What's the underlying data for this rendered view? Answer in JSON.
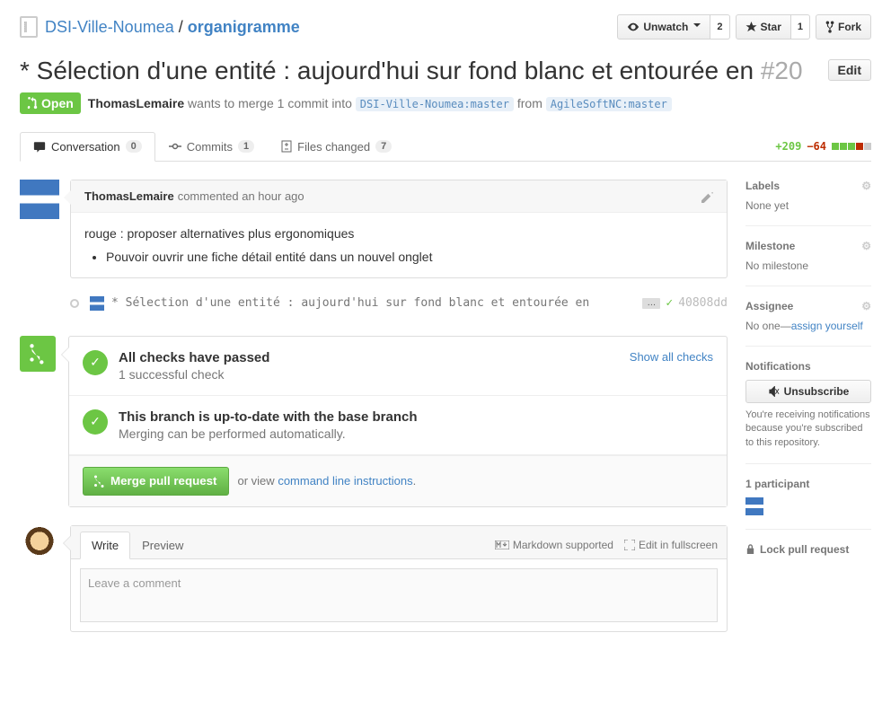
{
  "breadcrumb": {
    "owner": "DSI-Ville-Noumea",
    "sep": "/",
    "repo": "organigramme"
  },
  "actions": {
    "unwatch": "Unwatch",
    "unwatch_count": "2",
    "star": "Star",
    "star_count": "1",
    "fork": "Fork"
  },
  "issue": {
    "title": "* Sélection d'une entité : aujourd'hui sur fond blanc et entourée en",
    "number": "#20",
    "edit": "Edit",
    "state": "Open",
    "author": "ThomasLemaire",
    "wants": "wants to merge 1 commit into",
    "base_ref": "DSI-Ville-Noumea:master",
    "from": "from",
    "head_ref": "AgileSoftNC:master"
  },
  "tabs": {
    "conversation": "Conversation",
    "conversation_count": "0",
    "commits": "Commits",
    "commits_count": "1",
    "files": "Files changed",
    "files_count": "7",
    "add": "+209",
    "del": "−64"
  },
  "comment": {
    "author": "ThomasLemaire",
    "meta": "commented an hour ago",
    "body": "rouge : proposer alternatives plus ergonomiques",
    "bullet": "Pouvoir ouvrir une fiche détail entité dans un nouvel onglet"
  },
  "commit": {
    "msg": "* Sélection d'une entité : aujourd'hui sur fond blanc et entourée en",
    "ellipsis": "…",
    "sha": "40808dd"
  },
  "merge": {
    "checks_title": "All checks have passed",
    "checks_sub": "1 successful check",
    "show_all": "Show all checks",
    "uptodate_title": "This branch is up-to-date with the base branch",
    "uptodate_sub": "Merging can be performed automatically.",
    "merge_btn": "Merge pull request",
    "or_view": "or view",
    "cli": "command line instructions"
  },
  "write": {
    "write_tab": "Write",
    "preview_tab": "Preview",
    "md": "Markdown supported",
    "fullscreen": "Edit in fullscreen",
    "placeholder": "Leave a comment"
  },
  "sidebar": {
    "labels": "Labels",
    "labels_val": "None yet",
    "milestone": "Milestone",
    "milestone_val": "No milestone",
    "assignee": "Assignee",
    "assignee_val": "No one—",
    "assign_yourself": "assign yourself",
    "notifications": "Notifications",
    "unsubscribe": "Unsubscribe",
    "subtext": "You're receiving notifications because you're subscribed to this repository.",
    "participants": "1 participant",
    "lock": "Lock pull request"
  }
}
